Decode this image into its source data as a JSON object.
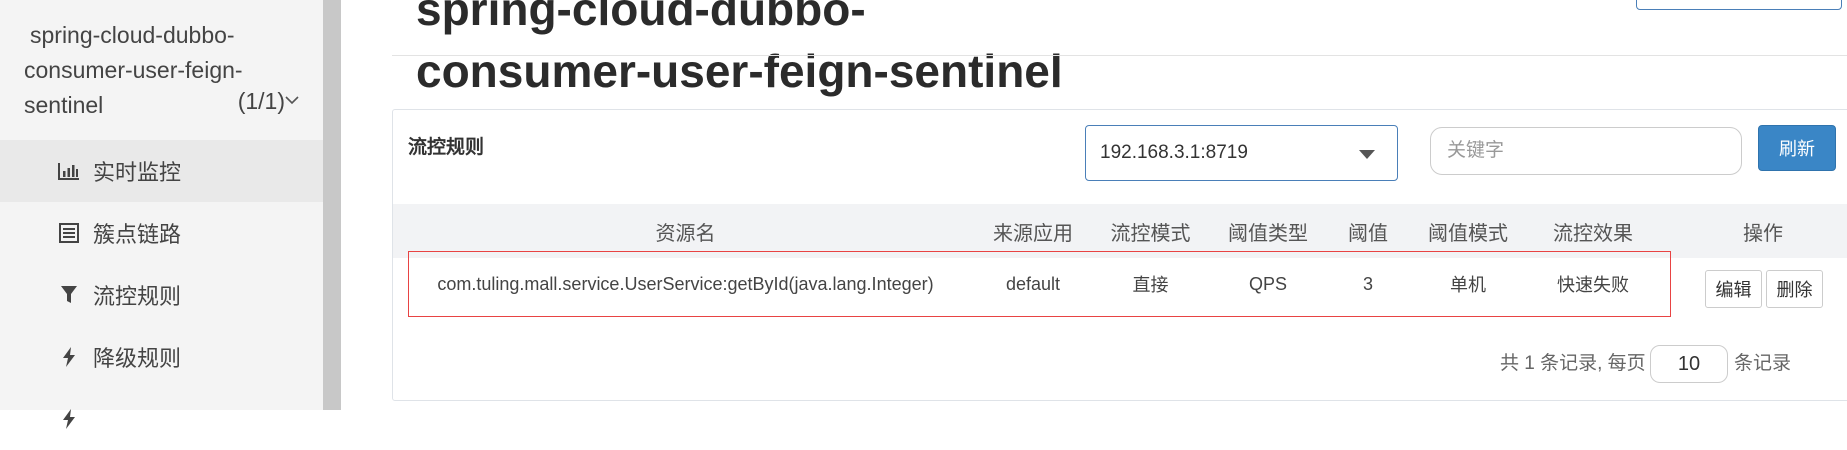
{
  "sidebar": {
    "app_name_line1": "spring-cloud-dubbo-",
    "app_name_line2": "consumer-user-feign-",
    "app_name_line3": "sentinel",
    "app_count": "(1/1)",
    "items": [
      {
        "label": "实时监控",
        "icon": "bar-chart-icon"
      },
      {
        "label": "簇点链路",
        "icon": "list-icon"
      },
      {
        "label": "流控规则",
        "icon": "filter-icon"
      },
      {
        "label": "降级规则",
        "icon": "flash-icon"
      },
      {
        "label": "",
        "icon": "flash-icon"
      }
    ]
  },
  "main": {
    "title_line1": "spring-cloud-dubbo-",
    "title_line2": "consumer-user-feign-sentinel"
  },
  "panel": {
    "title": "流控规则",
    "machine_select": "192.168.3.1:8719",
    "keyword_placeholder": "关键字",
    "refresh_label": "刷新"
  },
  "table": {
    "headers": [
      "资源名",
      "来源应用",
      "流控模式",
      "阈值类型",
      "阈值",
      "阈值模式",
      "流控效果",
      "操作"
    ],
    "rows": [
      {
        "resource": "com.tuling.mall.service.UserService:getById(java.lang.Integer)",
        "origin": "default",
        "mode": "直接",
        "threshold_type": "QPS",
        "threshold": "3",
        "threshold_mode": "单机",
        "effect": "快速失败",
        "edit_label": "编辑",
        "delete_label": "删除"
      }
    ]
  },
  "pager": {
    "prefix": "共 1 条记录, 每页",
    "page_size": "10",
    "suffix": "条记录"
  },
  "colors": {
    "primary": "#3a86c6",
    "highlight_border": "#e84343"
  }
}
